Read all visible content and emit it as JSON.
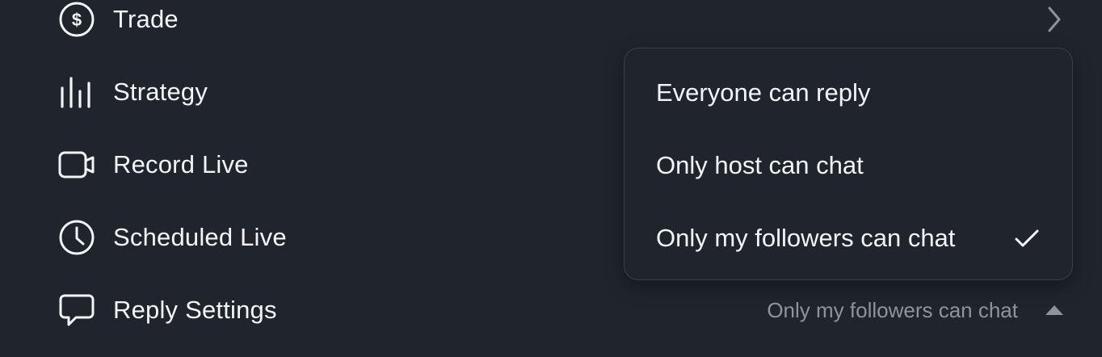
{
  "menu": {
    "items": [
      {
        "label": "Trade",
        "icon": "dollar-circle-icon"
      },
      {
        "label": "Strategy",
        "icon": "bars-icon"
      },
      {
        "label": "Record Live",
        "icon": "video-camera-icon"
      },
      {
        "label": "Scheduled Live",
        "icon": "clock-icon"
      },
      {
        "label": "Reply Settings",
        "icon": "chat-bubble-icon",
        "value": "Only my followers can chat"
      }
    ]
  },
  "dropdown": {
    "options": [
      {
        "label": "Everyone can reply",
        "selected": false
      },
      {
        "label": "Only host can chat",
        "selected": false
      },
      {
        "label": "Only my followers can chat",
        "selected": true
      }
    ]
  },
  "colors": {
    "background": "#20242d",
    "text": "#f3f4f6",
    "muted_text": "#8e939d",
    "border": "#3a3f4a"
  }
}
